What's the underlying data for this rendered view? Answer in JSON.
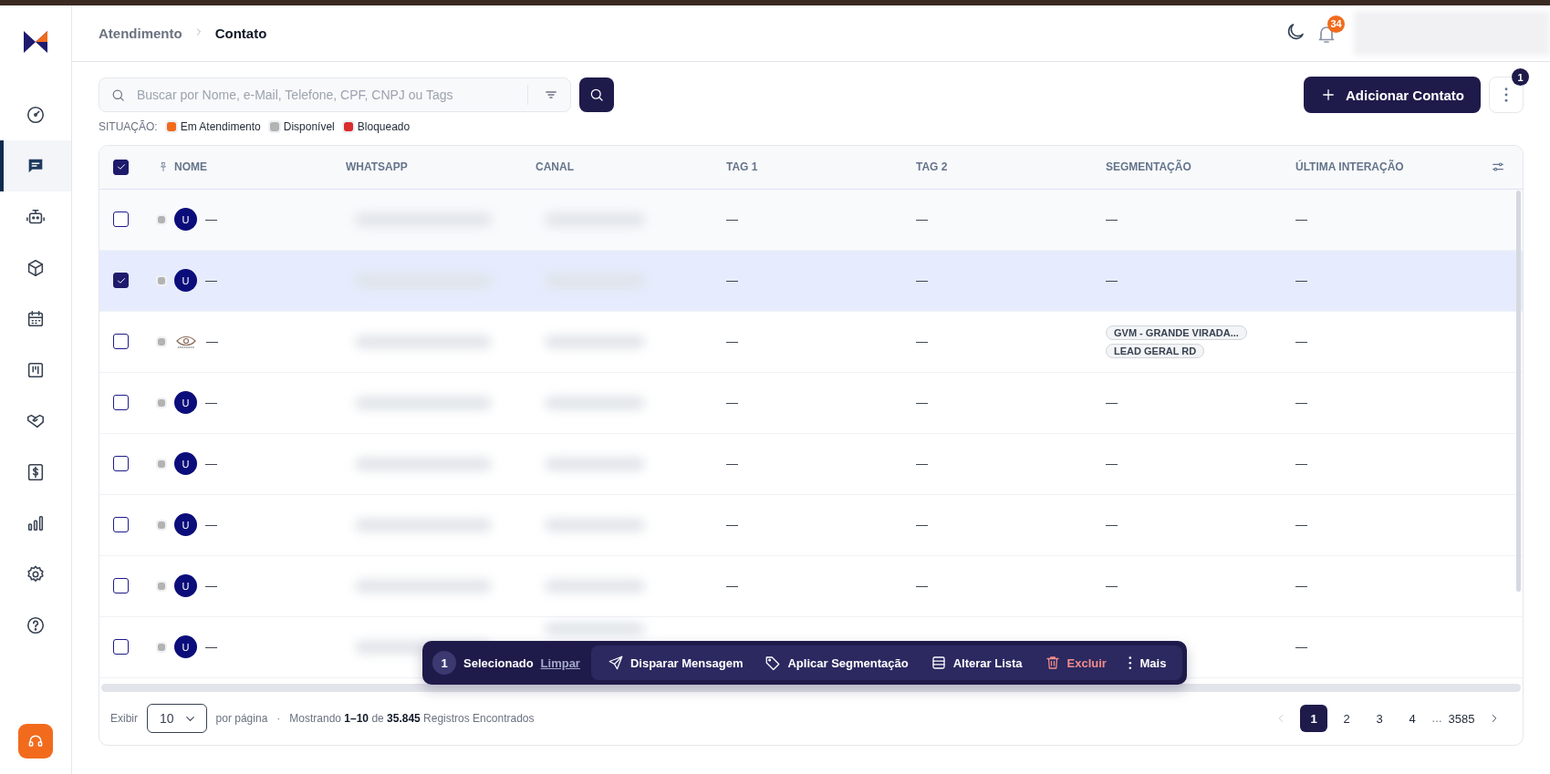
{
  "sidebar": {
    "items": [
      {
        "kind": "gauge",
        "selected": false
      },
      {
        "kind": "chat",
        "selected": true
      },
      {
        "kind": "robot",
        "selected": false
      },
      {
        "kind": "box",
        "selected": false
      },
      {
        "kind": "calendar",
        "selected": false
      },
      {
        "kind": "kanban",
        "selected": false
      },
      {
        "kind": "handshake",
        "selected": false
      },
      {
        "kind": "dollar",
        "selected": false
      },
      {
        "kind": "chart",
        "selected": false
      },
      {
        "kind": "gear",
        "selected": false
      },
      {
        "kind": "help",
        "selected": false
      }
    ]
  },
  "breadcrumb": [
    {
      "label": "Atendimento",
      "current": false
    },
    {
      "label": "Contato",
      "current": true
    }
  ],
  "header": {
    "notification_count": "34"
  },
  "search": {
    "placeholder": "Buscar por Nome, e-Mail, Telefone, CPF, CNPJ ou Tags"
  },
  "add_button": "Adicionar Contato",
  "more_badge": "1",
  "legend": {
    "label": "SITUAÇÃO:",
    "items": [
      {
        "label": "Em Atendimento",
        "color": "#f26b1d"
      },
      {
        "label": "Disponível",
        "color": "#b3b3b3"
      },
      {
        "label": "Bloqueado",
        "color": "#d92d2d"
      }
    ]
  },
  "table": {
    "select_all": true,
    "columns": [
      "NOME",
      "WHATSAPP",
      "CANAL",
      "TAG 1",
      "TAG 2",
      "SEGMENTAÇÃO",
      "ÚLTIMA INTERAÇÃO"
    ],
    "rows": [
      {
        "selected": false,
        "color": "#b3b3b3",
        "avatar": {
          "kind": "letter",
          "text": "U"
        },
        "name": "—",
        "tag_1": "—",
        "tag_2": "—",
        "segmentation": [
          {
            "kind": "text",
            "label": "—"
          }
        ],
        "last_interaction": "—"
      },
      {
        "selected": true,
        "color": "#b3b3b3",
        "avatar": {
          "kind": "letter",
          "text": "U"
        },
        "name": "—",
        "tag_1": "—",
        "tag_2": "—",
        "segmentation": [
          {
            "kind": "text",
            "label": "—"
          }
        ],
        "last_interaction": "—"
      },
      {
        "selected": false,
        "color": "#b3b3b3",
        "avatar": {
          "kind": "logo"
        },
        "name": "—",
        "tag_1": "—",
        "tag_2": "—",
        "segmentation": [
          {
            "kind": "tag",
            "label": "GVM - GRANDE VIRADA..."
          },
          {
            "kind": "tag",
            "label": "LEAD GERAL RD"
          }
        ],
        "last_interaction": "—"
      },
      {
        "selected": false,
        "color": "#b3b3b3",
        "avatar": {
          "kind": "letter",
          "text": "U"
        },
        "name": "—",
        "tag_1": "—",
        "tag_2": "—",
        "segmentation": [
          {
            "kind": "text",
            "label": "—"
          }
        ],
        "last_interaction": "—"
      },
      {
        "selected": false,
        "color": "#b3b3b3",
        "avatar": {
          "kind": "letter",
          "text": "U"
        },
        "name": "—",
        "tag_1": "—",
        "tag_2": "—",
        "segmentation": [
          {
            "kind": "text",
            "label": "—"
          }
        ],
        "last_interaction": "—"
      },
      {
        "selected": false,
        "color": "#b3b3b3",
        "avatar": {
          "kind": "letter",
          "text": "U"
        },
        "name": "—",
        "tag_1": "—",
        "tag_2": "—",
        "segmentation": [
          {
            "kind": "text",
            "label": "—"
          }
        ],
        "last_interaction": "—"
      },
      {
        "selected": false,
        "color": "#b3b3b3",
        "avatar": {
          "kind": "letter",
          "text": "U"
        },
        "name": "—",
        "tag_1": "—",
        "tag_2": "—",
        "segmentation": [
          {
            "kind": "text",
            "label": "—"
          }
        ],
        "last_interaction": "—"
      },
      {
        "selected": false,
        "color": "#b3b3b3",
        "avatar": {
          "kind": "letter",
          "text": "U"
        },
        "name": "—",
        "last_interaction": "—"
      }
    ]
  },
  "bulk_bar": {
    "count": "1",
    "label": "Selecionado",
    "clear": "Limpar",
    "actions": [
      {
        "kind": "send",
        "label": "Disparar Mensagem"
      },
      {
        "kind": "tag",
        "label": "Aplicar Segmentação"
      },
      {
        "kind": "list",
        "label": "Alterar Lista"
      },
      {
        "kind": "delete",
        "label": "Excluir"
      },
      {
        "kind": "more",
        "label": "Mais"
      }
    ]
  },
  "footer": {
    "show_label": "Exibir",
    "page_size": "10",
    "per_page": "por página",
    "separator": "·",
    "summary": "Mostrando **1–10** de **35.845** Registros Encontrados",
    "pages": [
      {
        "kind": "page",
        "label": "1",
        "selected": true
      },
      {
        "kind": "page",
        "label": "2",
        "selected": false
      },
      {
        "kind": "page",
        "label": "3",
        "selected": false
      },
      {
        "kind": "page",
        "label": "4",
        "selected": false
      },
      {
        "kind": "ellipsis",
        "label": "…",
        "selected": false
      },
      {
        "kind": "page",
        "label": "3585",
        "selected": false
      }
    ]
  }
}
